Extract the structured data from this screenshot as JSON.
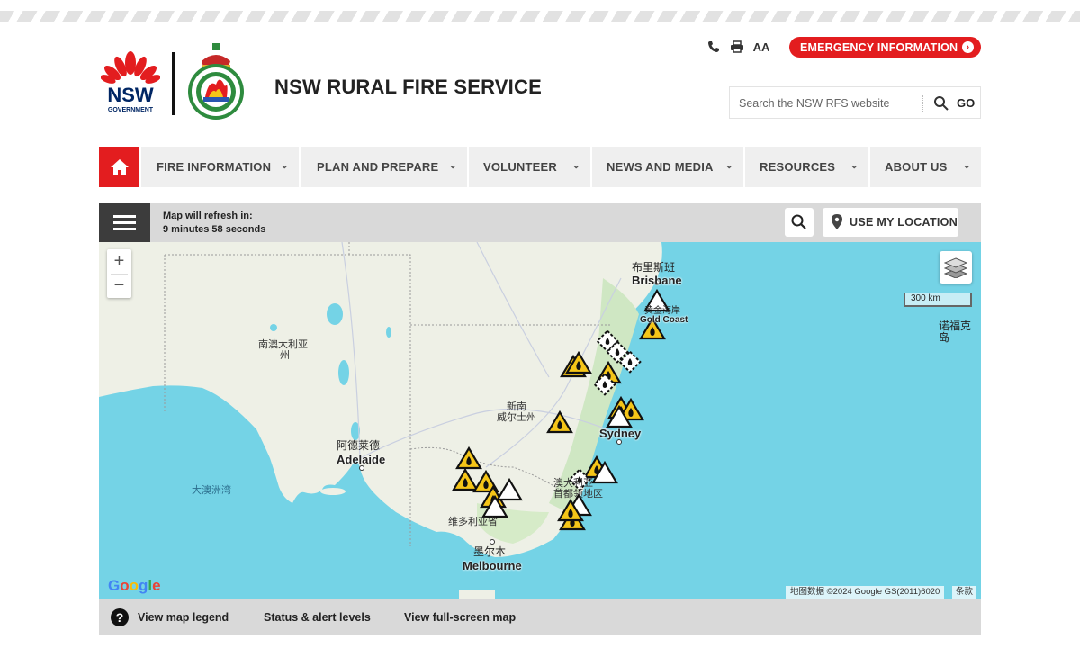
{
  "site": {
    "title": "NSW RURAL FIRE SERVICE",
    "nsw_logo_text": "NSW",
    "nsw_logo_sub": "GOVERNMENT"
  },
  "header": {
    "emergency_label": "EMERGENCY INFORMATION",
    "search_placeholder": "Search the NSW RFS website",
    "go_label": "GO",
    "text_size_label": "AA"
  },
  "nav": {
    "items": [
      {
        "label": "FIRE INFORMATION"
      },
      {
        "label": "PLAN AND PREPARE"
      },
      {
        "label": "VOLUNTEER"
      },
      {
        "label": "NEWS AND MEDIA"
      },
      {
        "label": "RESOURCES"
      },
      {
        "label": "ABOUT US"
      }
    ]
  },
  "map_toolbar": {
    "refresh_label": "Map will refresh in:",
    "refresh_time": "9 minutes 58 seconds",
    "use_location_label": "USE MY LOCATION"
  },
  "map": {
    "labels": {
      "brisbane_zh": "布里斯班",
      "brisbane_en": "Brisbane",
      "goldcoast_zh": "黄金海岸",
      "goldcoast_en": "Gold Coast",
      "nsw_zh_1": "新南",
      "nsw_zh_2": "威尔士州",
      "sydney_en": "Sydney",
      "sa_zh_1": "南澳大利亚",
      "sa_zh_2": "州",
      "adelaide_zh": "阿德莱德",
      "adelaide_en": "Adelaide",
      "bight_zh": "大澳洲湾",
      "act_zh_1": "澳大利亚",
      "act_zh_2": "首都领地区",
      "vic_zh": "维多利亚省",
      "melbourne_zh": "墨尔本",
      "melbourne_en": "Melbourne",
      "norfolk_zh": "诺福克岛"
    },
    "zoom_in": "+",
    "zoom_out": "−",
    "scale_label": "300 km",
    "google_logo": "Google",
    "attribution": "地图数据 ©2024 Google GS(2011)6020",
    "terms": "条款",
    "colors": {
      "sea": "#74d3e6",
      "land": "#eef0e6",
      "fire_yellow": "#f5c518"
    }
  },
  "legend_bar": {
    "help_icon": "?",
    "legend_link": "View map legend",
    "status_link": "Status & alert levels",
    "fullscreen_link": "View full-screen map"
  }
}
